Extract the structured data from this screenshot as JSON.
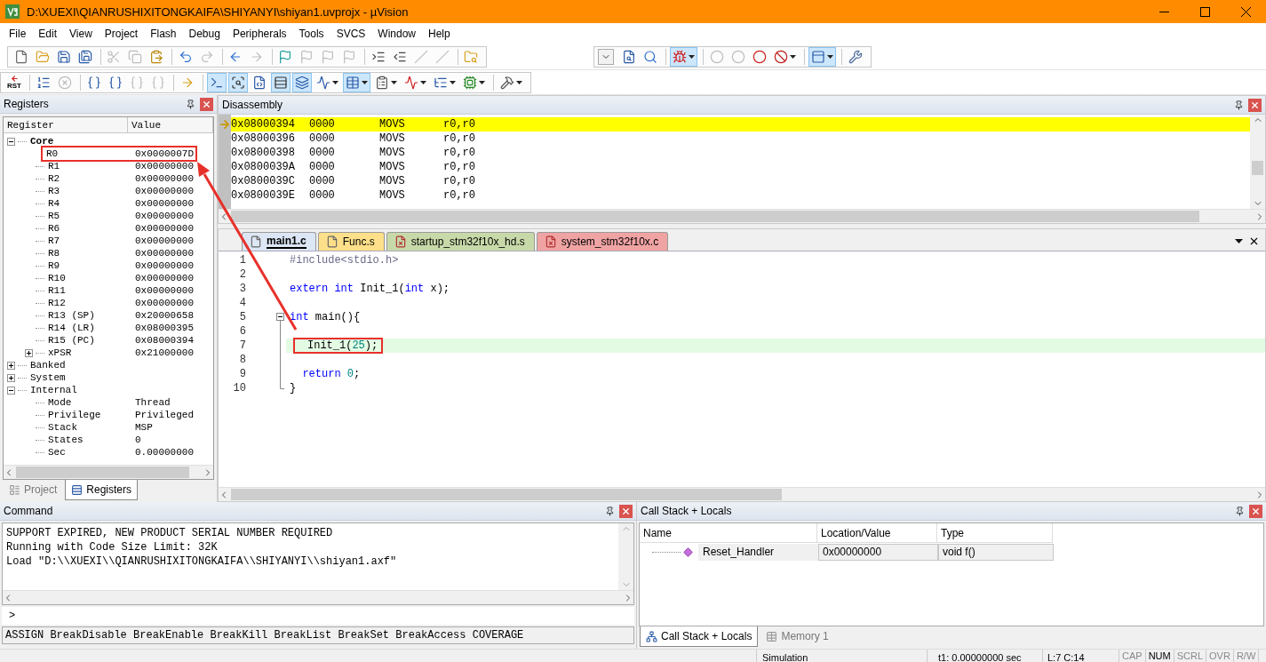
{
  "window": {
    "title": "D:\\XUEXI\\QIANRUSHIXITONGKAIFA\\SHIYANYI\\shiyan1.uvprojx - µVision"
  },
  "menu": [
    "File",
    "Edit",
    "View",
    "Project",
    "Flash",
    "Debug",
    "Peripherals",
    "Tools",
    "SVCS",
    "Window",
    "Help"
  ],
  "toolbar_1": [
    [
      [
        {
          "kind": "button",
          "disabled": false,
          "pressed": false,
          "dropdown": false
        },
        {
          "kind": "button",
          "disabled": false,
          "pressed": false,
          "dropdown": false
        },
        {
          "kind": "button",
          "disabled": false,
          "pressed": false,
          "dropdown": false
        },
        {
          "kind": "button",
          "disabled": false,
          "pressed": false,
          "dropdown": false
        }
      ],
      [
        {
          "kind": "button",
          "disabled": true,
          "pressed": false,
          "dropdown": false
        },
        {
          "kind": "button",
          "disabled": true,
          "pressed": false,
          "dropdown": false
        },
        {
          "kind": "button",
          "disabled": false,
          "pressed": false,
          "dropdown": false
        }
      ],
      [
        {
          "kind": "button",
          "disabled": false,
          "pressed": false,
          "dropdown": false
        },
        {
          "kind": "button",
          "disabled": true,
          "pressed": false,
          "dropdown": false
        }
      ],
      [
        {
          "kind": "button",
          "disabled": false,
          "pressed": false,
          "dropdown": false
        },
        {
          "kind": "button",
          "disabled": true,
          "pressed": false,
          "dropdown": false
        }
      ],
      [
        {
          "kind": "button",
          "disabled": false,
          "pressed": false,
          "dropdown": false
        },
        {
          "kind": "button",
          "disabled": true,
          "pressed": false,
          "dropdown": false
        },
        {
          "kind": "button",
          "disabled": true,
          "pressed": false,
          "dropdown": false
        },
        {
          "kind": "button",
          "disabled": true,
          "pressed": false,
          "dropdown": false
        }
      ],
      [
        {
          "kind": "button",
          "disabled": false,
          "pressed": false,
          "dropdown": false
        },
        {
          "kind": "button",
          "disabled": false,
          "pressed": false,
          "dropdown": false
        },
        {
          "kind": "button",
          "disabled": true,
          "pressed": false,
          "dropdown": false
        },
        {
          "kind": "button",
          "disabled": true,
          "pressed": false,
          "dropdown": false
        }
      ],
      [
        {
          "kind": "button",
          "disabled": false,
          "pressed": false,
          "dropdown": false
        }
      ]
    ],
    [
      [
        {
          "kind": "combo",
          "disabled": false,
          "pressed": false,
          "dropdown": true
        },
        {
          "kind": "button",
          "disabled": false,
          "pressed": false,
          "dropdown": false
        },
        {
          "kind": "button",
          "disabled": false,
          "pressed": false,
          "dropdown": false
        }
      ],
      [
        {
          "kind": "button",
          "disabled": false,
          "pressed": true,
          "dropdown": true
        }
      ],
      [
        {
          "kind": "button",
          "disabled": true,
          "pressed": false,
          "dropdown": false
        },
        {
          "kind": "button",
          "disabled": true,
          "pressed": false,
          "dropdown": false
        },
        {
          "kind": "button",
          "disabled": false,
          "pressed": false,
          "dropdown": false
        },
        {
          "kind": "button",
          "disabled": false,
          "pressed": false,
          "dropdown": true
        }
      ],
      [
        {
          "kind": "button",
          "disabled": false,
          "pressed": true,
          "dropdown": true
        }
      ],
      [
        {
          "kind": "button",
          "disabled": false,
          "pressed": false,
          "dropdown": false
        }
      ]
    ]
  ],
  "toolbar_2": [
    [
      [
        {
          "kind": "button",
          "label": "RST",
          "disabled": false,
          "pressed": false,
          "dropdown": false
        }
      ],
      [
        {
          "kind": "button",
          "disabled": false,
          "pressed": false,
          "dropdown": false
        },
        {
          "kind": "button",
          "disabled": true,
          "pressed": false,
          "dropdown": false
        }
      ],
      [
        {
          "kind": "button",
          "disabled": false,
          "pressed": false,
          "dropdown": false
        },
        {
          "kind": "button",
          "disabled": false,
          "pressed": false,
          "dropdown": false
        },
        {
          "kind": "button",
          "disabled": true,
          "pressed": false,
          "dropdown": false
        },
        {
          "kind": "button",
          "disabled": true,
          "pressed": false,
          "dropdown": false
        }
      ],
      [
        {
          "kind": "button",
          "disabled": false,
          "pressed": false,
          "dropdown": false
        }
      ],
      [
        {
          "kind": "button",
          "disabled": false,
          "pressed": true,
          "dropdown": false
        },
        {
          "kind": "button",
          "disabled": false,
          "pressed": true,
          "dropdown": false
        },
        {
          "kind": "button",
          "disabled": false,
          "pressed": false,
          "dropdown": false
        },
        {
          "kind": "button",
          "disabled": false,
          "pressed": true,
          "dropdown": false
        },
        {
          "kind": "button",
          "disabled": false,
          "pressed": true,
          "dropdown": false
        },
        {
          "kind": "button",
          "disabled": false,
          "pressed": false,
          "dropdown": true
        },
        {
          "kind": "button",
          "disabled": false,
          "pressed": true,
          "dropdown": true
        },
        {
          "kind": "button",
          "disabled": false,
          "pressed": false,
          "dropdown": true
        },
        {
          "kind": "button",
          "disabled": false,
          "pressed": false,
          "dropdown": true
        },
        {
          "kind": "button",
          "disabled": false,
          "pressed": false,
          "dropdown": true
        },
        {
          "kind": "button",
          "disabled": false,
          "pressed": false,
          "dropdown": true
        }
      ],
      [
        {
          "kind": "button",
          "disabled": false,
          "pressed": false,
          "dropdown": true
        }
      ]
    ]
  ],
  "registers": {
    "title": "Registers",
    "columns": [
      "Register",
      "Value"
    ],
    "tree": [
      {
        "name": "Core",
        "bold": true,
        "expanded": true,
        "children": [
          {
            "name": "R0",
            "value": "0x0000007D",
            "highlighted": true
          },
          {
            "name": "R1",
            "value": "0x00000000",
            "highlighted": false
          },
          {
            "name": "R2",
            "value": "0x00000000",
            "highlighted": false
          },
          {
            "name": "R3",
            "value": "0x00000000",
            "highlighted": false
          },
          {
            "name": "R4",
            "value": "0x00000000",
            "highlighted": false
          },
          {
            "name": "R5",
            "value": "0x00000000",
            "highlighted": false
          },
          {
            "name": "R6",
            "value": "0x00000000",
            "highlighted": false
          },
          {
            "name": "R7",
            "value": "0x00000000",
            "highlighted": false
          },
          {
            "name": "R8",
            "value": "0x00000000",
            "highlighted": false
          },
          {
            "name": "R9",
            "value": "0x00000000",
            "highlighted": false
          },
          {
            "name": "R10",
            "value": "0x00000000",
            "highlighted": false
          },
          {
            "name": "R11",
            "value": "0x00000000",
            "highlighted": false
          },
          {
            "name": "R12",
            "value": "0x00000000",
            "highlighted": false
          },
          {
            "name": "R13 (SP)",
            "value": "0x20000658",
            "highlighted": false
          },
          {
            "name": "R14 (LR)",
            "value": "0x08000395",
            "highlighted": false
          },
          {
            "name": "R15 (PC)",
            "value": "0x08000394",
            "highlighted": false
          },
          {
            "name": "xPSR",
            "value": "0x21000000",
            "highlighted": false,
            "expanded": false
          }
        ]
      },
      {
        "name": "Banked",
        "bold": false,
        "expanded": false
      },
      {
        "name": "System",
        "bold": false,
        "expanded": false
      },
      {
        "name": "Internal",
        "bold": false,
        "expanded": true,
        "children": [
          {
            "name": "Mode",
            "value": "Thread",
            "highlighted": false
          },
          {
            "name": "Privilege",
            "value": "Privileged",
            "highlighted": false
          },
          {
            "name": "Stack",
            "value": "MSP",
            "highlighted": false
          },
          {
            "name": "States",
            "value": "0",
            "highlighted": false
          },
          {
            "name": "Sec",
            "value": "0.00000000",
            "highlighted": false
          }
        ]
      }
    ]
  },
  "left_tabs": [
    {
      "label": "Project",
      "selected": false
    },
    {
      "label": "Registers",
      "selected": true
    }
  ],
  "disassembly": {
    "title": "Disassembly",
    "rows": [
      {
        "address": "0x08000394",
        "opcode": "0000",
        "mnemonic": "MOVS",
        "operands": "r0,r0",
        "current": true
      },
      {
        "address": "0x08000396",
        "opcode": "0000",
        "mnemonic": "MOVS",
        "operands": "r0,r0",
        "current": false
      },
      {
        "address": "0x08000398",
        "opcode": "0000",
        "mnemonic": "MOVS",
        "operands": "r0,r0",
        "current": false
      },
      {
        "address": "0x0800039A",
        "opcode": "0000",
        "mnemonic": "MOVS",
        "operands": "r0,r0",
        "current": false
      },
      {
        "address": "0x0800039C",
        "opcode": "0000",
        "mnemonic": "MOVS",
        "operands": "r0,r0",
        "current": false
      },
      {
        "address": "0x0800039E",
        "opcode": "0000",
        "mnemonic": "MOVS",
        "operands": "r0,r0",
        "current": false
      }
    ]
  },
  "editor": {
    "tabs": [
      {
        "label": "main1.c",
        "selected": true,
        "color": "#dce6f4",
        "kind": "file"
      },
      {
        "label": "Func.s",
        "selected": false,
        "color": "#ffe08a",
        "kind": "file"
      },
      {
        "label": "startup_stm32f10x_hd.s",
        "selected": false,
        "color": "#c8d9a9",
        "kind": "excluded"
      },
      {
        "label": "system_stm32f10x.c",
        "selected": false,
        "color": "#f0a3a3",
        "kind": "excluded"
      }
    ],
    "lines": [
      {
        "number": "1",
        "kind": "plain",
        "current": false,
        "boxed": false,
        "tokens": [
          {
            "text": "#include<stdio.h>",
            "kind": "preproc"
          }
        ]
      },
      {
        "number": "2",
        "kind": "plain",
        "current": false
      },
      {
        "number": "3",
        "kind": "plain",
        "current": false,
        "boxed": false,
        "tokens": [
          {
            "text": "extern",
            "kind": "keyword"
          },
          {
            "text": " int",
            "kind": "keyword"
          },
          {
            "text": " Init_1(",
            "kind": "plain"
          },
          {
            "text": "int",
            "kind": "keyword"
          },
          {
            "text": " x);",
            "kind": "plain"
          }
        ]
      },
      {
        "number": "4",
        "kind": "plain",
        "current": false
      },
      {
        "number": "5",
        "kind": "fold_start",
        "current": false,
        "boxed": false,
        "tokens": [
          {
            "text": "int",
            "kind": "keyword"
          },
          {
            "text": " main(){",
            "kind": "plain"
          }
        ]
      },
      {
        "number": "6",
        "kind": "fold_body",
        "current": false
      },
      {
        "number": "7",
        "kind": "fold_body",
        "current": true,
        "boxed": true,
        "tokens": [
          {
            "text": "Init_1(",
            "kind": "plain"
          },
          {
            "text": "25",
            "kind": "number"
          },
          {
            "text": ");",
            "kind": "plain"
          }
        ]
      },
      {
        "number": "8",
        "kind": "fold_body",
        "current": false
      },
      {
        "number": "9",
        "kind": "fold_body",
        "current": false,
        "boxed": false,
        "tokens": [
          {
            "text": "  return",
            "kind": "keyword"
          },
          {
            "text": " 0",
            "kind": "number"
          },
          {
            "text": ";",
            "kind": "plain"
          }
        ]
      },
      {
        "number": "10",
        "kind": "fold_end",
        "current": false,
        "boxed": false,
        "tokens": [
          {
            "text": "}",
            "kind": "plain"
          }
        ]
      }
    ]
  },
  "command": {
    "title": "Command",
    "output": [
      "SUPPORT EXPIRED, NEW PRODUCT SERIAL NUMBER REQUIRED",
      "Running with Code Size Limit: 32K",
      "Load \"D:\\\\XUEXI\\\\QIANRUSHIXITONGKAIFA\\\\SHIYANYI\\\\shiyan1.axf\""
    ],
    "prompt": ">",
    "hints": "ASSIGN BreakDisable BreakEnable BreakKill BreakList BreakSet BreakAccess COVERAGE"
  },
  "call_stack": {
    "title": "Call Stack + Locals",
    "columns": [
      "Name",
      "Location/Value",
      "Type"
    ],
    "rows": [
      {
        "name": "Reset_Handler",
        "location": "0x00000000",
        "type": "void f()"
      }
    ],
    "tabs": [
      {
        "label": "Call Stack + Locals",
        "selected": true
      },
      {
        "label": "Memory 1",
        "selected": false
      }
    ]
  },
  "status_bar": {
    "mode": "Simulation",
    "time": "t1: 0.00000000 sec",
    "position": "L:7 C:14",
    "indicators": [
      {
        "label": "CAP",
        "on": false
      },
      {
        "label": "NUM",
        "on": true
      },
      {
        "label": "SCRL",
        "on": false
      },
      {
        "label": "OVR",
        "on": false
      },
      {
        "label": "R/W",
        "on": false
      }
    ]
  }
}
